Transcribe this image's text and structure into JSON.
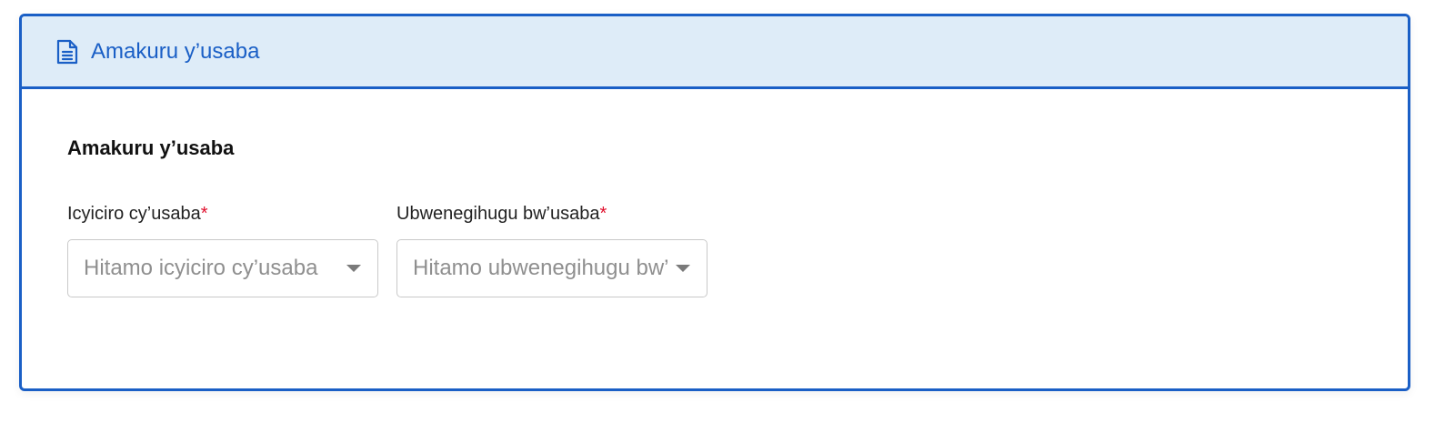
{
  "header": {
    "icon": "document-icon",
    "title": "Amakuru y’usaba"
  },
  "section": {
    "title": "Amakuru y’usaba"
  },
  "fields": [
    {
      "label": "Icyiciro cy’usaba",
      "required_mark": "*",
      "placeholder": "Hitamo icyiciro cy’usaba",
      "icon": "caret-down-icon"
    },
    {
      "label": "Ubwenegihugu bw’usaba",
      "required_mark": "*",
      "placeholder": "Hitamo ubwenegihugu bw’usaba",
      "icon": "caret-down-icon"
    }
  ],
  "colors": {
    "accent": "#1a5fc6",
    "header_bg": "#deecf8",
    "required": "#e0102d",
    "placeholder": "#8f8f8f"
  }
}
